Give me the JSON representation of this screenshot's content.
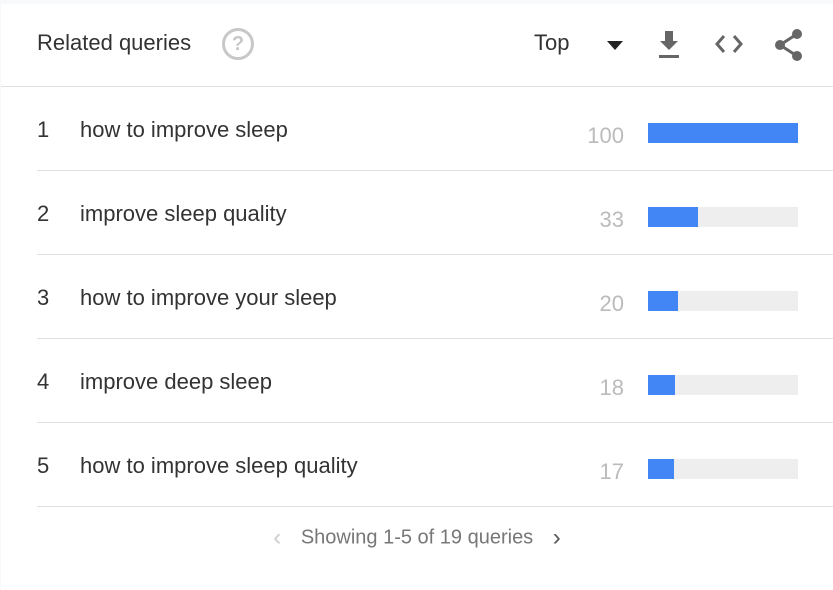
{
  "header": {
    "title": "Related queries",
    "help_icon": "help-circle-icon",
    "selector": "Top"
  },
  "colors": {
    "bar": "#4285f4",
    "track": "#eeeeee"
  },
  "rows": [
    {
      "rank": "1",
      "query": "how to improve sleep",
      "value": "100",
      "fill": 100
    },
    {
      "rank": "2",
      "query": "improve sleep quality",
      "value": "33",
      "fill": 33
    },
    {
      "rank": "3",
      "query": "how to improve your sleep",
      "value": "20",
      "fill": 20
    },
    {
      "rank": "4",
      "query": "improve deep sleep",
      "value": "18",
      "fill": 18
    },
    {
      "rank": "5",
      "query": "how to improve sleep quality",
      "value": "17",
      "fill": 17
    }
  ],
  "footer": {
    "text": "Showing 1-5 of 19 queries",
    "prev": "‹",
    "next": "›"
  }
}
